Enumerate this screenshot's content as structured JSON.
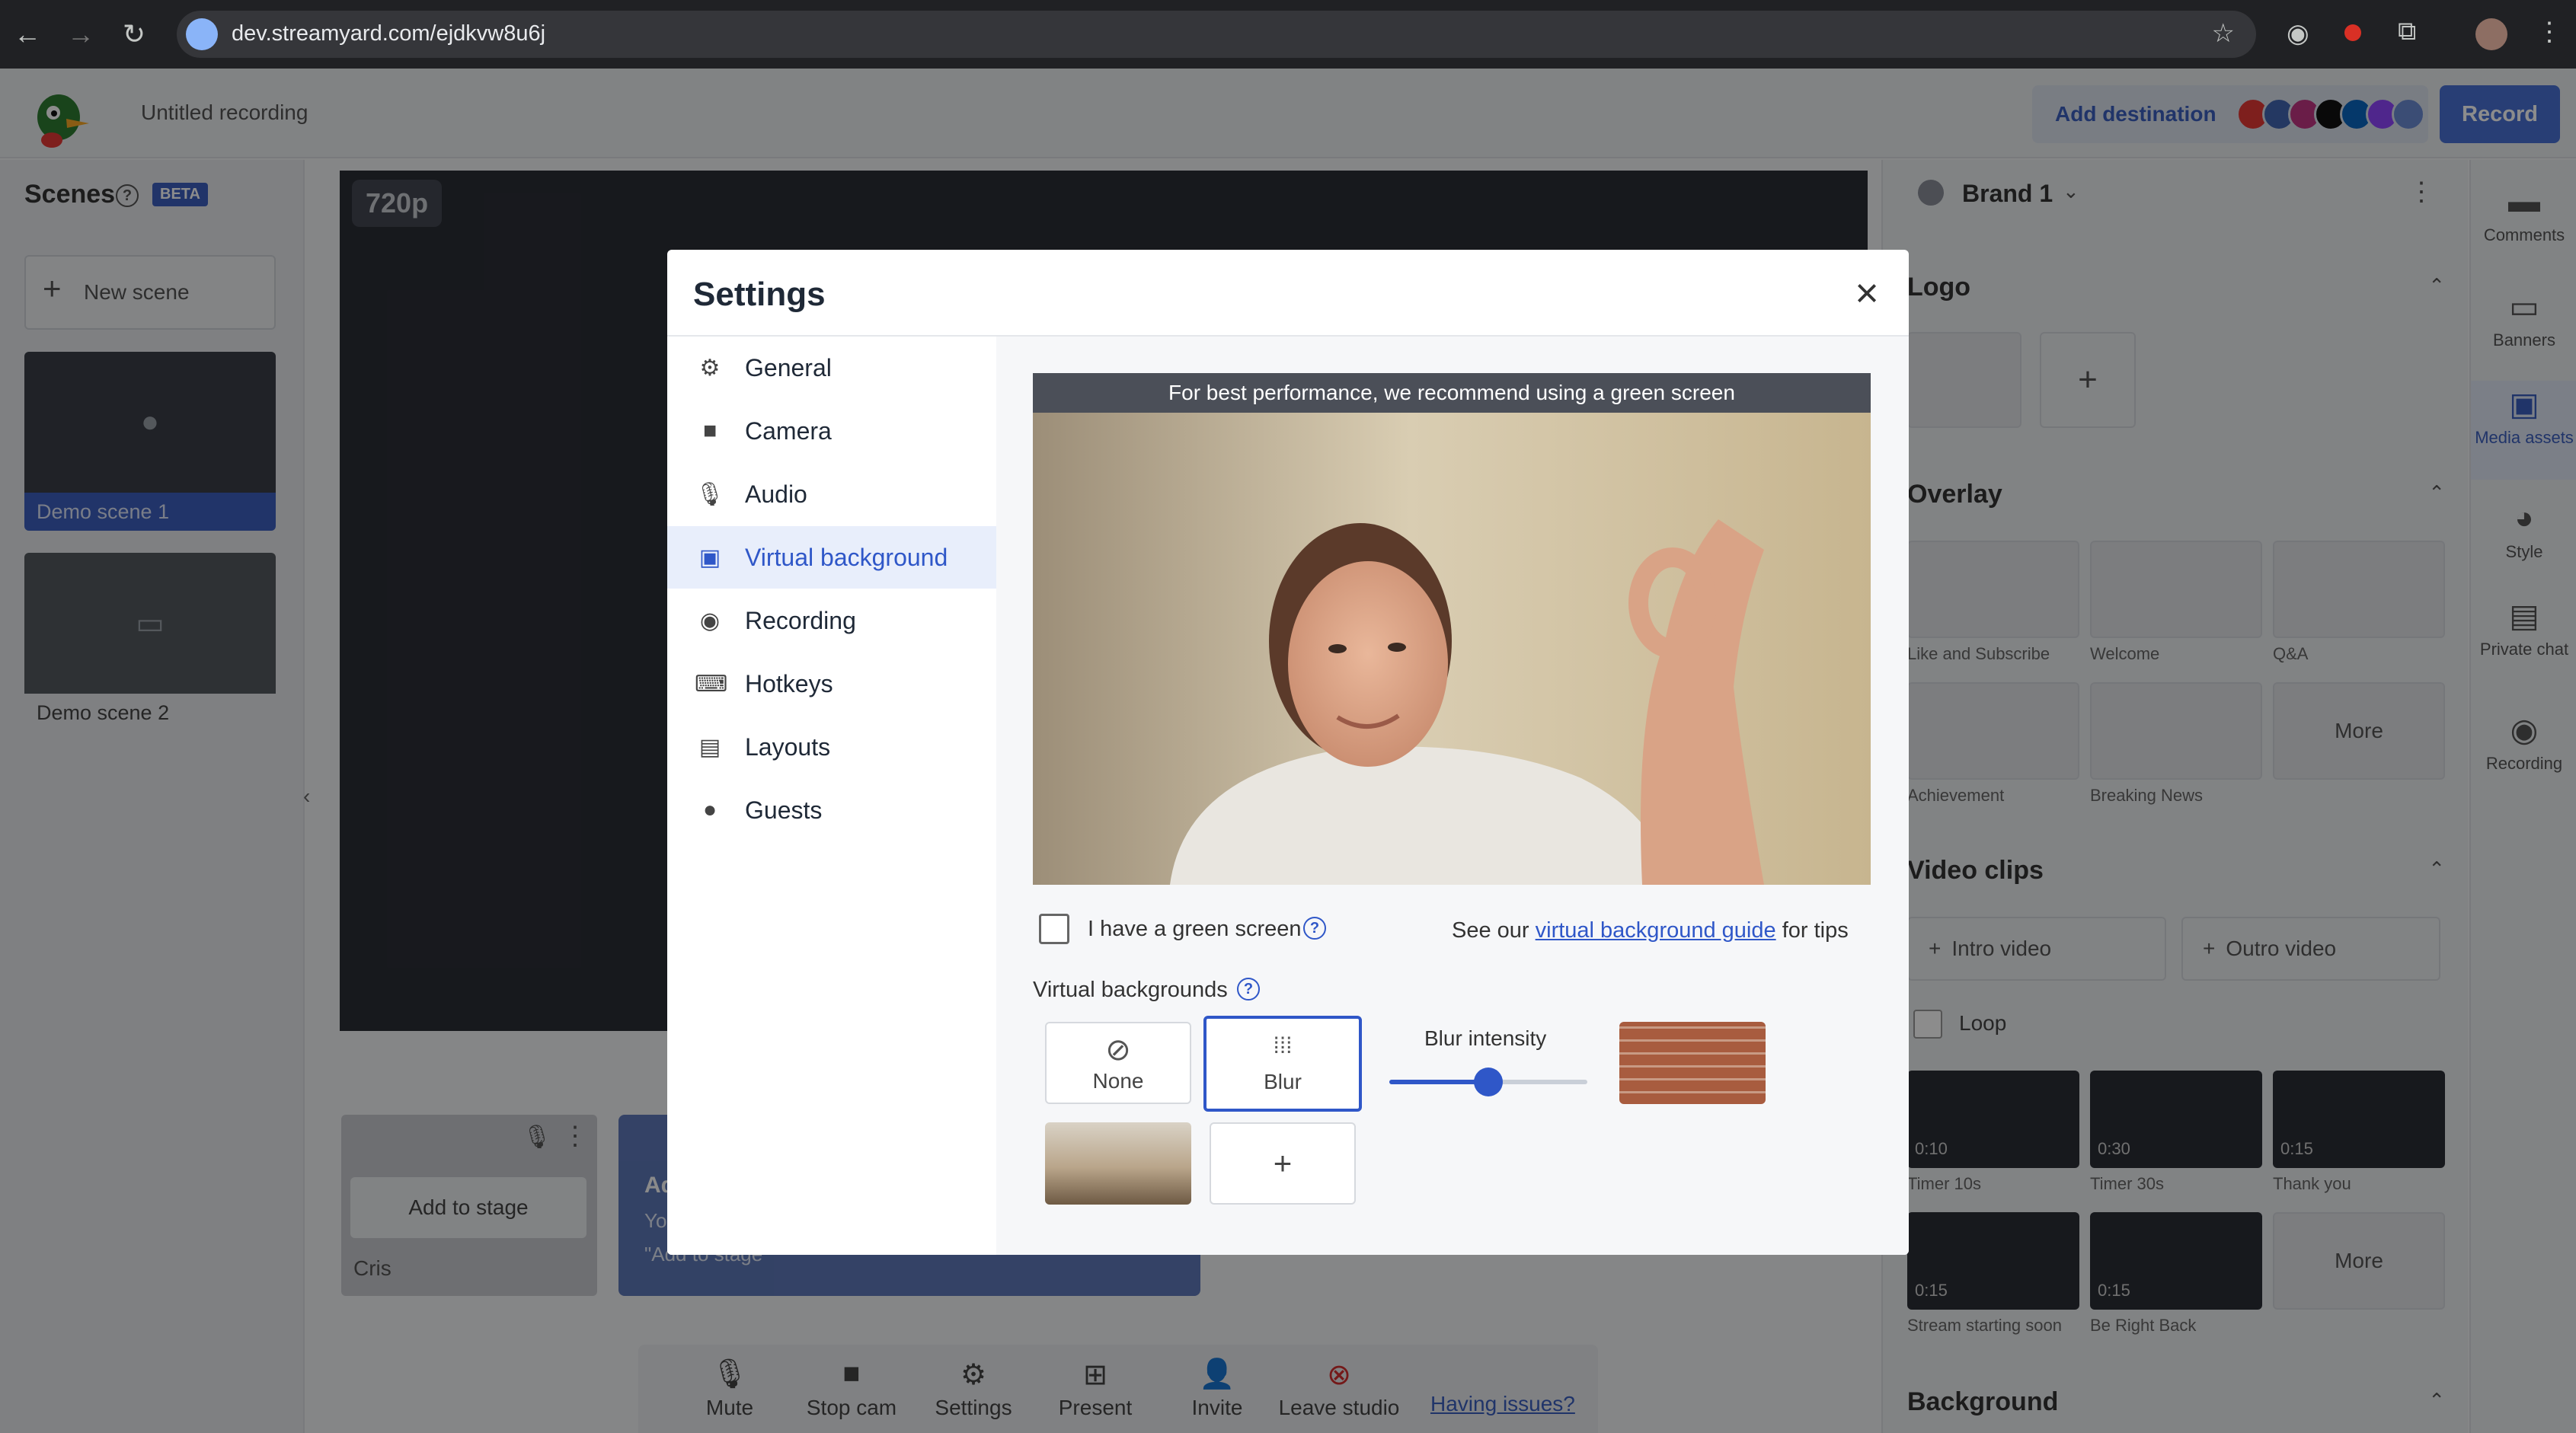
{
  "browser": {
    "url": "dev.streamyard.com/ejdkvw8u6j"
  },
  "header": {
    "recording_title": "Untitled recording",
    "add_destination": "Add destination",
    "record": "Record",
    "destination_colors": [
      "#e53935",
      "#4267b2",
      "#c13584",
      "#111111",
      "#0a66c2",
      "#9146ff",
      "#6c8cd5"
    ]
  },
  "scenes": {
    "title": "Scenes",
    "badge": "BETA",
    "new_scene": "New scene",
    "items": [
      {
        "label": "Demo scene 1"
      },
      {
        "label": "Demo scene 2"
      }
    ]
  },
  "stage": {
    "resolution": "720p",
    "add_to_stage": "Add to stage",
    "participant": "Cris",
    "hint_line1": "Ad",
    "hint_line2": "Yo",
    "hint_line3": "\"Add to stage\""
  },
  "toolbar": {
    "items": [
      {
        "label": "Mute",
        "icon": "mic-icon"
      },
      {
        "label": "Stop cam",
        "icon": "camera-icon"
      },
      {
        "label": "Settings",
        "icon": "gear-icon"
      },
      {
        "label": "Present",
        "icon": "present-icon"
      },
      {
        "label": "Invite",
        "icon": "invite-icon"
      },
      {
        "label": "Leave studio",
        "icon": "leave-icon"
      }
    ],
    "having_issues": "Having issues?"
  },
  "right_panel": {
    "brand": "Brand 1",
    "logo_title": "Logo",
    "overlay_title": "Overlay",
    "overlays": [
      "Like and Subscribe",
      "Welcome",
      "Q&A",
      "Achievement",
      "Breaking News"
    ],
    "more": "More",
    "video_clips_title": "Video clips",
    "intro_video": "Intro video",
    "outro_video": "Outro video",
    "loop": "Loop",
    "clips": [
      {
        "duration": "0:10",
        "label": "Timer 10s"
      },
      {
        "duration": "0:30",
        "label": "Timer 30s"
      },
      {
        "duration": "0:15",
        "label": "Thank you"
      },
      {
        "duration": "0:15",
        "label": "Stream starting soon"
      },
      {
        "duration": "0:15",
        "label": "Be Right Back"
      }
    ],
    "background_title": "Background"
  },
  "rail": {
    "items": [
      {
        "label": "Comments",
        "icon": "comment-icon"
      },
      {
        "label": "Banners",
        "icon": "banner-icon"
      },
      {
        "label": "Media assets",
        "icon": "media-icon"
      },
      {
        "label": "Style",
        "icon": "palette-icon"
      },
      {
        "label": "Private chat",
        "icon": "chat-icon"
      },
      {
        "label": "Recording",
        "icon": "record-icon"
      }
    ]
  },
  "modal": {
    "title": "Settings",
    "nav": [
      {
        "label": "General",
        "icon": "gear-icon"
      },
      {
        "label": "Camera",
        "icon": "camera-icon"
      },
      {
        "label": "Audio",
        "icon": "mic-icon"
      },
      {
        "label": "Virtual background",
        "icon": "person-badge-icon"
      },
      {
        "label": "Recording",
        "icon": "record-icon"
      },
      {
        "label": "Hotkeys",
        "icon": "keyboard-icon"
      },
      {
        "label": "Layouts",
        "icon": "layout-icon"
      },
      {
        "label": "Guests",
        "icon": "person-icon"
      }
    ],
    "active_nav": "Virtual background",
    "preview_banner": "For best performance, we recommend using a green screen",
    "green_screen_label": "I have a green screen",
    "tips_prefix": "See our",
    "tips_link": "virtual background guide",
    "tips_suffix": "for tips",
    "vb_label": "Virtual backgrounds",
    "vb_none": "None",
    "vb_blur": "Blur",
    "blur_intensity": "Blur intensity",
    "blur_value": 0.5,
    "accent": "#2f57c8"
  }
}
